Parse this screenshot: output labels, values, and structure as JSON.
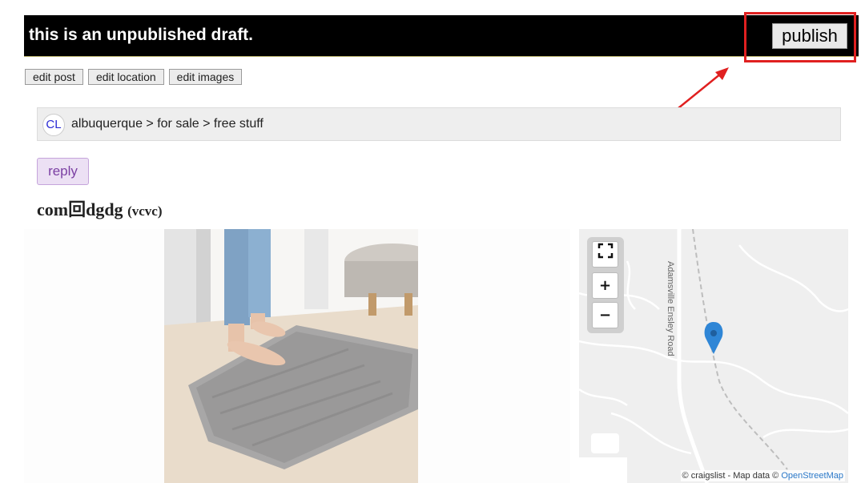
{
  "banner": {
    "draft_message": "this is an unpublished draft.",
    "publish_label": "publish"
  },
  "edit_actions": [
    {
      "label": "edit post"
    },
    {
      "label": "edit location"
    },
    {
      "label": "edit images"
    }
  ],
  "breadcrumb": {
    "logo_text": "CL",
    "path": "albuquerque > for sale > free stuff"
  },
  "reply_label": "reply",
  "post": {
    "title": "com回dgdg",
    "subtitle": "(vcvc)"
  },
  "map": {
    "road_label": "Adamsville Ensley Road",
    "attribution_prefix": "© craigslist - Map data ©",
    "attribution_link": "OpenStreetMap",
    "controls": {
      "fullscreen": "⛶",
      "zoom_in": "+",
      "zoom_out": "−"
    }
  },
  "colors": {
    "banner_bg": "#000000",
    "annotation_red": "#e02020",
    "reply_purple": "#7b3fa3",
    "map_pin": "#2f86d6"
  }
}
